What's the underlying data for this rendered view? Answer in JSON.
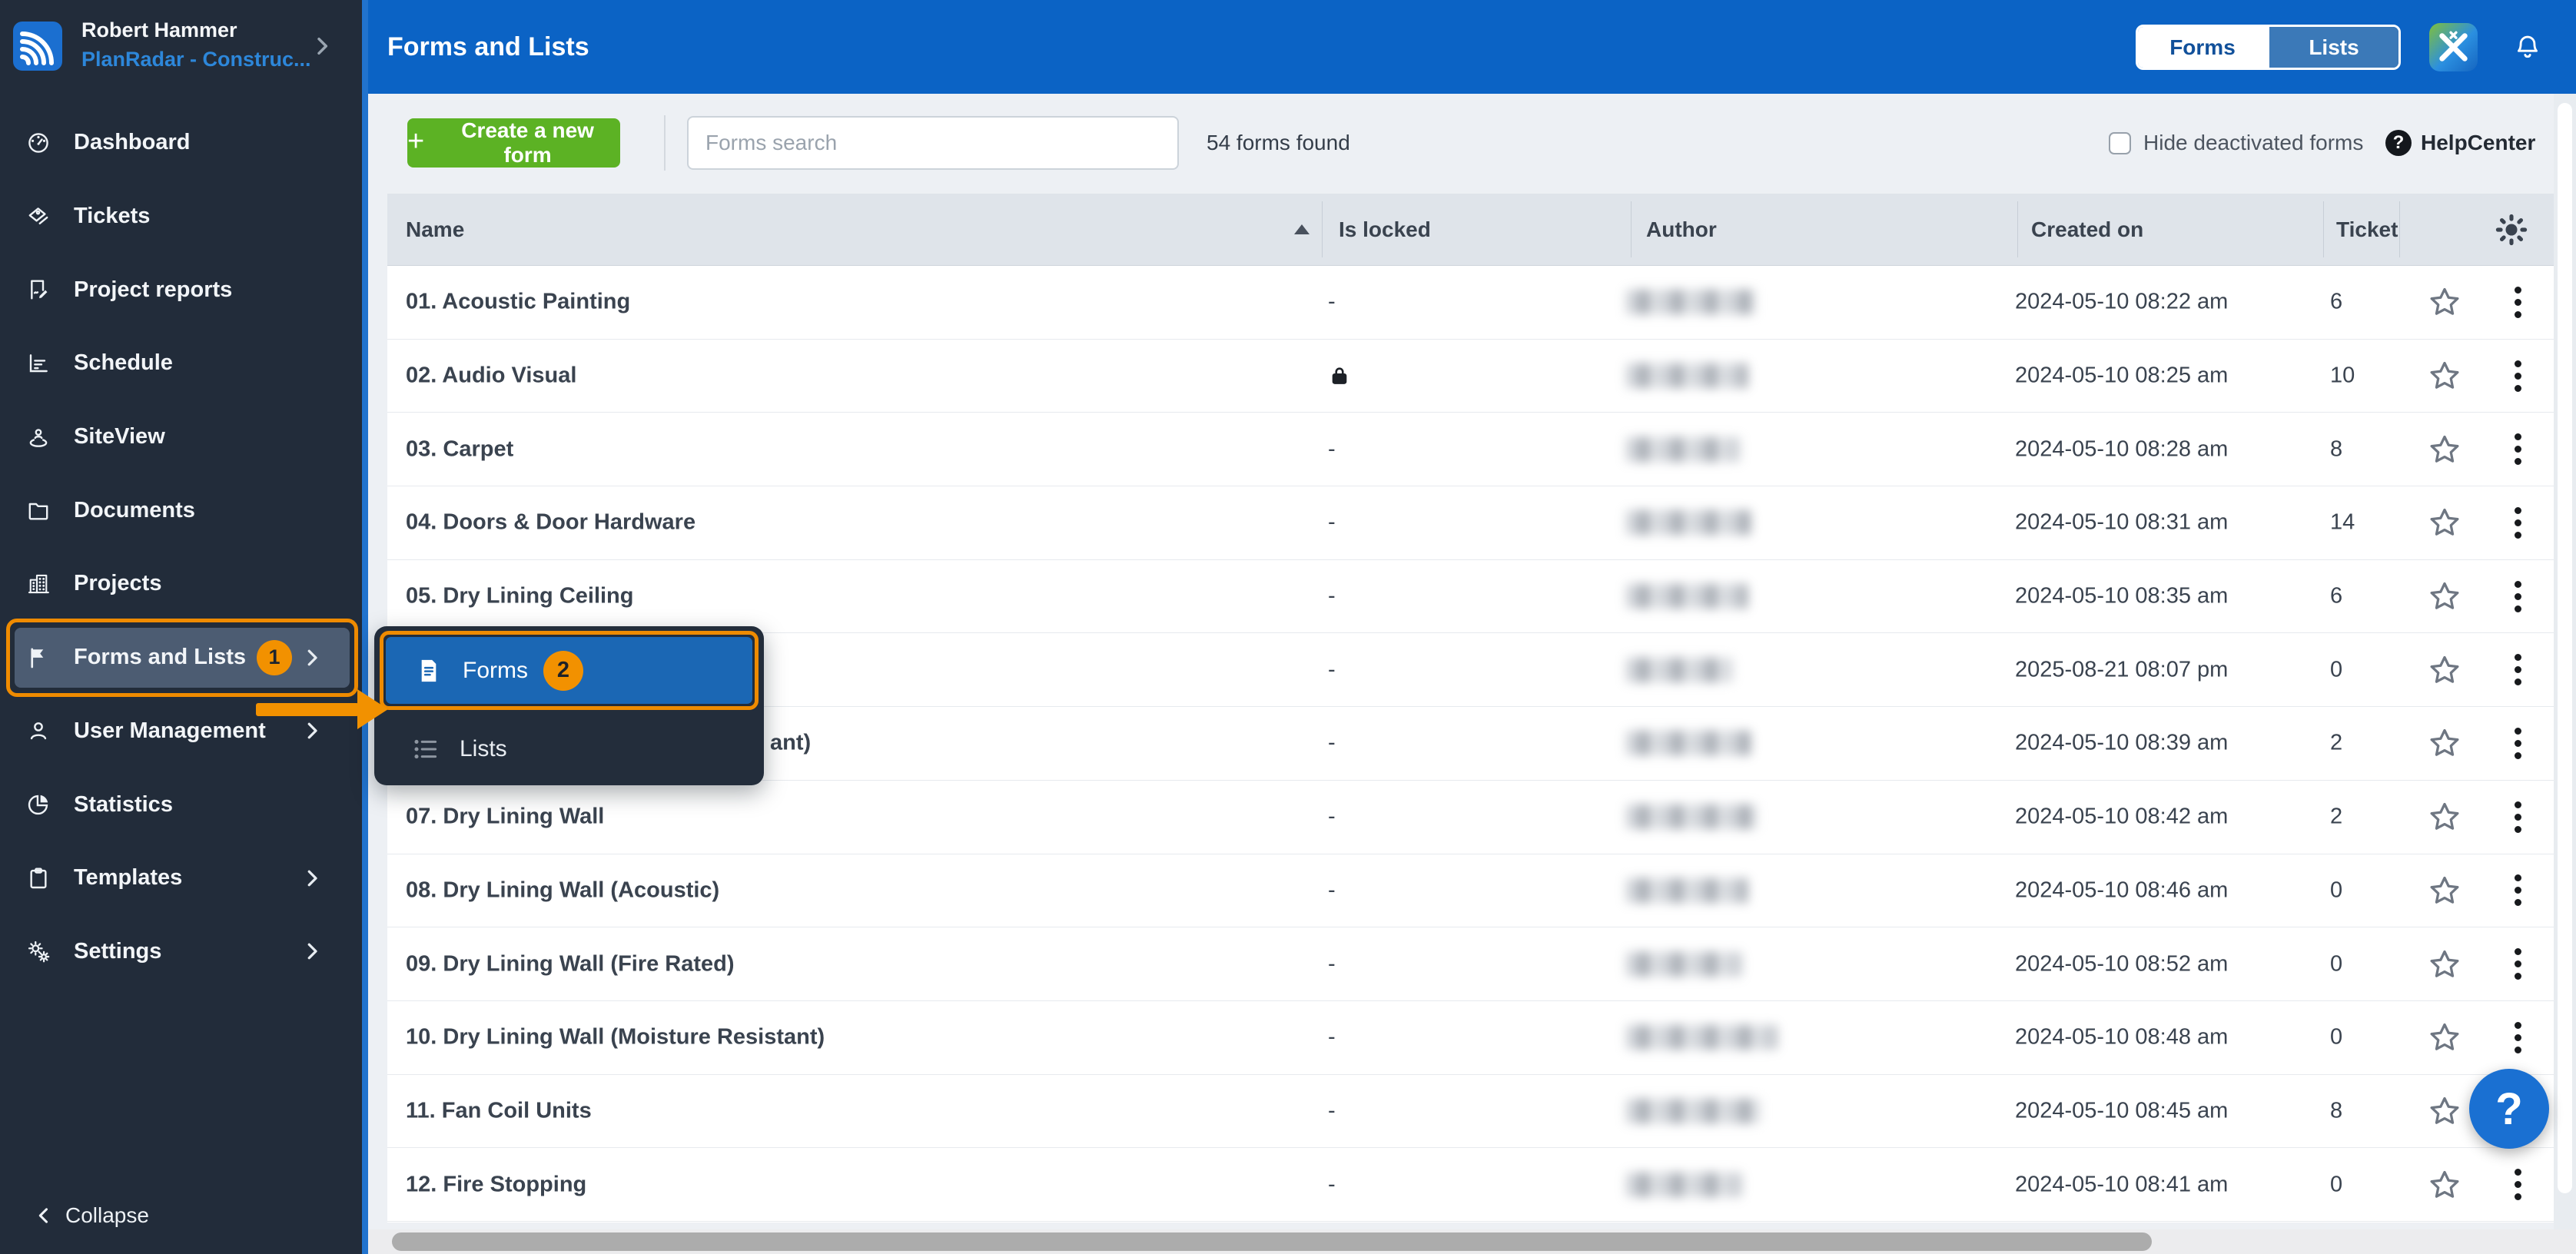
{
  "sidebar": {
    "user": {
      "name": "Robert Hammer",
      "account": "PlanRadar - Construc..."
    },
    "items": [
      {
        "id": "dashboard",
        "label": "Dashboard",
        "icon": "dashboard-icon"
      },
      {
        "id": "tickets",
        "label": "Tickets",
        "icon": "tickets-icon"
      },
      {
        "id": "project-reports",
        "label": "Project reports",
        "icon": "project-reports-icon"
      },
      {
        "id": "schedule",
        "label": "Schedule",
        "icon": "schedule-icon"
      },
      {
        "id": "siteview",
        "label": "SiteView",
        "icon": "siteview-icon"
      },
      {
        "id": "documents",
        "label": "Documents",
        "icon": "documents-icon"
      },
      {
        "id": "projects",
        "label": "Projects",
        "icon": "projects-icon"
      },
      {
        "id": "forms-and-lists",
        "label": "Forms and Lists",
        "icon": "flag-icon",
        "chevron": true,
        "active": true,
        "badge": "1"
      },
      {
        "id": "user-management",
        "label": "User Management",
        "icon": "user-icon",
        "chevron": true
      },
      {
        "id": "statistics",
        "label": "Statistics",
        "icon": "statistics-icon"
      },
      {
        "id": "templates",
        "label": "Templates",
        "icon": "templates-icon",
        "chevron": true
      },
      {
        "id": "settings",
        "label": "Settings",
        "icon": "settings-icon",
        "chevron": true
      }
    ],
    "collapse_label": "Collapse"
  },
  "header": {
    "title": "Forms and Lists",
    "toggle": {
      "forms_label": "Forms",
      "lists_label": "Lists",
      "active": "Forms"
    }
  },
  "toolbar": {
    "create_button_label": "Create a new form",
    "search_placeholder": "Forms search",
    "results_text": "54 forms found",
    "hide_deactivated_label": "Hide deactivated forms",
    "help_center_label": "HelpCenter"
  },
  "table": {
    "columns": {
      "name": "Name",
      "is_locked": "Is locked",
      "author": "Author",
      "created_on": "Created on",
      "ticket": "Ticket"
    },
    "rows": [
      {
        "name": "01. Acoustic Painting",
        "is_locked": "-",
        "author_blurred": true,
        "created_on": "2024-05-10 08:22 am",
        "tickets": "6"
      },
      {
        "name": "02. Audio Visual",
        "is_locked": "locked",
        "author_blurred": true,
        "created_on": "2024-05-10 08:25 am",
        "tickets": "10"
      },
      {
        "name": "03. Carpet",
        "is_locked": "-",
        "author_blurred": true,
        "created_on": "2024-05-10 08:28 am",
        "tickets": "8"
      },
      {
        "name": "04. Doors & Door Hardware",
        "is_locked": "-",
        "author_blurred": true,
        "created_on": "2024-05-10 08:31 am",
        "tickets": "14"
      },
      {
        "name": "05. Dry Lining Ceiling",
        "is_locked": "-",
        "author_blurred": true,
        "created_on": "2024-05-10 08:35 am",
        "tickets": "6"
      },
      {
        "name": "",
        "is_locked": "-",
        "author_blurred": true,
        "created_on": "2025-08-21 08:07 pm",
        "tickets": "0",
        "hidden_by_popup": "full"
      },
      {
        "name": "ant)",
        "is_locked": "-",
        "author_blurred": true,
        "created_on": "2024-05-10 08:39 am",
        "tickets": "2",
        "hidden_by_popup": "partial"
      },
      {
        "name": "07. Dry Lining Wall",
        "is_locked": "-",
        "author_blurred": true,
        "created_on": "2024-05-10 08:42 am",
        "tickets": "2"
      },
      {
        "name": "08. Dry Lining Wall (Acoustic)",
        "is_locked": "-",
        "author_blurred": true,
        "created_on": "2024-05-10 08:46 am",
        "tickets": "0"
      },
      {
        "name": "09. Dry Lining Wall (Fire Rated)",
        "is_locked": "-",
        "author_blurred": true,
        "created_on": "2024-05-10 08:52 am",
        "tickets": "0"
      },
      {
        "name": "10. Dry Lining Wall (Moisture Resistant)",
        "is_locked": "-",
        "author_blurred": true,
        "created_on": "2024-05-10 08:48 am",
        "tickets": "0"
      },
      {
        "name": "11. Fan Coil Units",
        "is_locked": "-",
        "author_blurred": true,
        "created_on": "2024-05-10 08:45 am",
        "tickets": "8"
      },
      {
        "name": "12. Fire Stopping",
        "is_locked": "-",
        "author_blurred": true,
        "created_on": "2024-05-10 08:41 am",
        "tickets": "0"
      }
    ]
  },
  "popup": {
    "items": [
      {
        "label": "Forms",
        "icon": "form-icon",
        "active": true,
        "badge": "2"
      },
      {
        "label": "Lists",
        "icon": "list-icon"
      }
    ]
  },
  "floating_help_label": "?",
  "help_icon_glyph": "?",
  "colors": {
    "header_blue": "#0b63c5",
    "popup_item_blue": "#1b67b4",
    "create_green": "#5cb224",
    "annotation_orange": "#f29100",
    "sidebar_navy": "#222c3a",
    "sidebar_highlight": "#4c5c72"
  }
}
